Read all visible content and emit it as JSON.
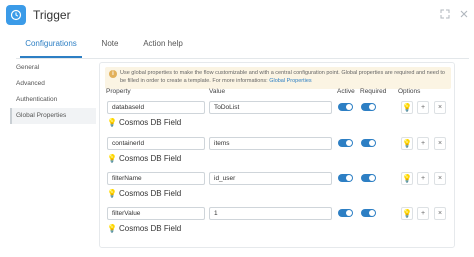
{
  "header": {
    "title": "Trigger",
    "icon": "clock-icon",
    "accent": "#3b9be8"
  },
  "tabs": [
    {
      "label": "Configurations",
      "active": true
    },
    {
      "label": "Note",
      "active": false
    },
    {
      "label": "Action help",
      "active": false
    }
  ],
  "sidebar": {
    "items": [
      {
        "label": "General",
        "active": false
      },
      {
        "label": "Advanced",
        "active": false
      },
      {
        "label": "Authentication",
        "active": false
      },
      {
        "label": "Global Properties",
        "active": true
      }
    ]
  },
  "info": {
    "text": "Use global properties to make the flow customizable and with a central configuration point. Global properties are required and need to be filled in order to create a template. For more informations: ",
    "link": "Global Properties"
  },
  "columns": {
    "property": "Property",
    "value": "Value",
    "active": "Active",
    "required": "Required",
    "options": "Options"
  },
  "rows": [
    {
      "property": "databaseId",
      "value": "ToDoList",
      "field_label": "Cosmos DB Field",
      "active": true,
      "required": true
    },
    {
      "property": "containerId",
      "value": "items",
      "field_label": "Cosmos DB Field",
      "active": true,
      "required": true
    },
    {
      "property": "filterName",
      "value": "id_user",
      "field_label": "Cosmos DB Field",
      "active": true,
      "required": true
    },
    {
      "property": "filterValue",
      "value": "1",
      "field_label": "Cosmos DB Field",
      "active": true,
      "required": true
    }
  ],
  "options": {
    "bulb": "bulb-icon",
    "add": "+",
    "remove": "×"
  }
}
